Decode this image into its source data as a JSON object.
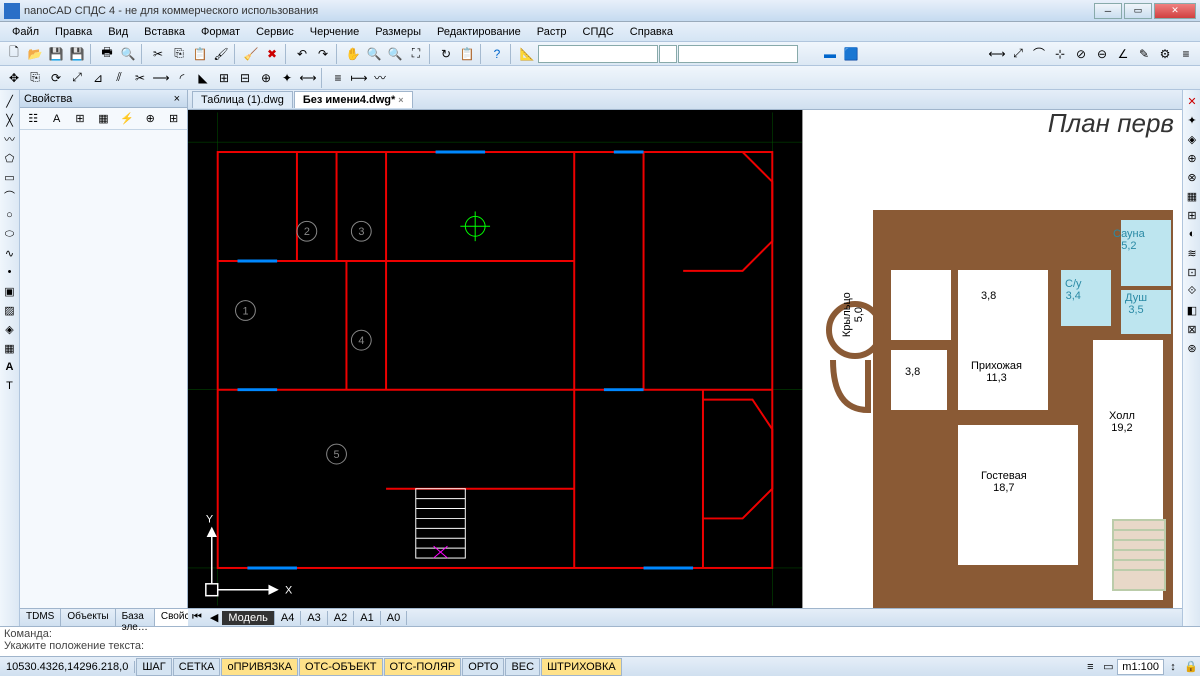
{
  "window": {
    "title": "nanoCAD СПДС 4 - не для коммерческого использования"
  },
  "menu": [
    "Файл",
    "Правка",
    "Вид",
    "Вставка",
    "Формат",
    "Сервис",
    "Черчение",
    "Размеры",
    "Редактирование",
    "Растр",
    "СПДС",
    "Справка"
  ],
  "props": {
    "title": "Свойства"
  },
  "left_tabs": [
    "TDMS",
    "Объекты",
    "База эле…",
    "Свойства"
  ],
  "file_tabs": [
    {
      "label": "Таблица (1).dwg",
      "active": false
    },
    {
      "label": "Без имени4.dwg*",
      "active": true
    }
  ],
  "model_tabs": [
    "Модель",
    "A4",
    "A3",
    "A2",
    "A1",
    "A0"
  ],
  "cmd": {
    "line1": "Команда:",
    "line2": "Укажите положение текста:"
  },
  "status": {
    "coords": "10530.4326,14296.218,0",
    "buttons": [
      {
        "label": "ШАГ",
        "on": false
      },
      {
        "label": "СЕТКА",
        "on": false
      },
      {
        "label": "оПРИВЯЗКА",
        "on": true
      },
      {
        "label": "ОТС-ОБЪЕКТ",
        "on": true
      },
      {
        "label": "ОТС-ПОЛЯР",
        "on": true
      },
      {
        "label": "ОРТО",
        "on": false
      },
      {
        "label": "ВЕС",
        "on": false
      },
      {
        "label": "ШТРИХОВКА",
        "on": true
      }
    ],
    "scale": "m1:100"
  },
  "ucs": {
    "x": "X",
    "y": "Y"
  },
  "drawing_numbers": [
    "1",
    "2",
    "3",
    "4",
    "5"
  ],
  "plan": {
    "title": "План перв",
    "rooms": {
      "sauna": {
        "name": "Сауна",
        "area": "5,2"
      },
      "wc": {
        "name": "С/у",
        "area": "3,4"
      },
      "shower": {
        "name": "Душ",
        "area": "3,5"
      },
      "r38a": {
        "name": "",
        "area": "3,8"
      },
      "r38b": {
        "name": "",
        "area": "3,8"
      },
      "hall": {
        "name": "Прихожая",
        "area": "11,3"
      },
      "holl": {
        "name": "Холл",
        "area": "19,2"
      },
      "guest": {
        "name": "Гостевая",
        "area": "18,7"
      },
      "porch": {
        "name": "Крыльцо",
        "area": "5,0"
      }
    }
  }
}
